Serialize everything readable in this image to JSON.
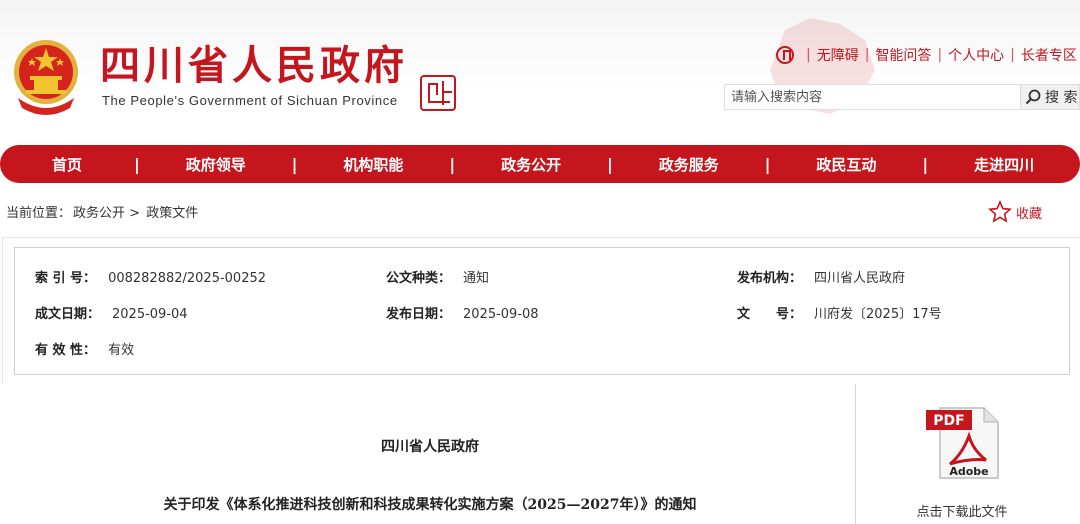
{
  "header": {
    "title": "四川省人民政府",
    "subtitle": "The People's Government of Sichuan Province",
    "links": [
      "无障碍",
      "智能问答",
      "个人中心",
      "长者专区"
    ],
    "search_placeholder": "请输入搜索内容",
    "search_button": "搜 索"
  },
  "nav": {
    "items": [
      "首页",
      "政府领导",
      "机构职能",
      "政务公开",
      "政务服务",
      "政民互动",
      "走进四川"
    ]
  },
  "breadcrumb": {
    "prefix": "当前位置：",
    "items": [
      "政务公开",
      ">",
      "政策文件"
    ]
  },
  "favorite_label": "收藏",
  "info": {
    "index_label": "索 引 号：",
    "index_value": "008282882/2025-00252",
    "type_label": "公文种类：",
    "type_value": "通知",
    "issuer_label": "发布机构：",
    "issuer_value": "四川省人民政府",
    "written_label": "成文日期：",
    "written_value": "2025-09-04",
    "published_label": "发布日期：",
    "published_value": "2025-09-08",
    "docno_label": "文　　号：",
    "docno_value": "川府发〔2025〕17号",
    "validity_label": "有 效 性：",
    "validity_value": "有效"
  },
  "document": {
    "issuer": "四川省人民政府",
    "title": "关于印发《体系化推进科技创新和科技成果转化实施方案（2025—2027年）》的通知"
  },
  "download": {
    "pdf_label": "PDF",
    "brand_label": "Adobe",
    "label": "点击下载此文件"
  },
  "colors": {
    "brand_red": "#c4161c"
  }
}
